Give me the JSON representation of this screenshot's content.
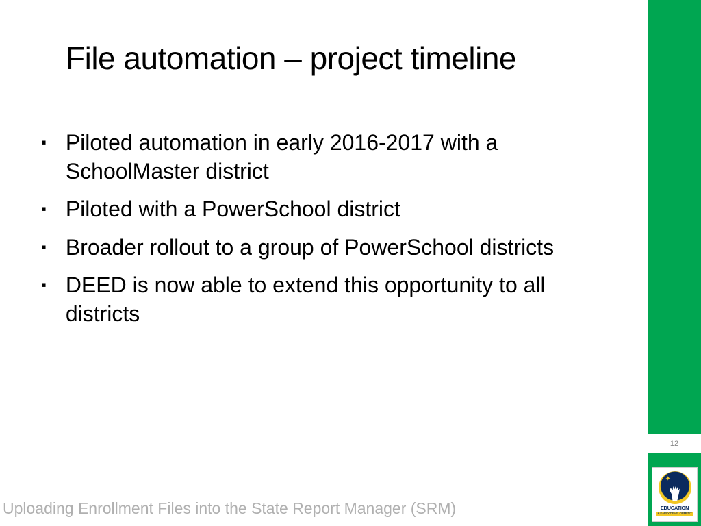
{
  "title": "File automation – project timeline",
  "bullets": [
    "Piloted automation in early 2016-2017 with a SchoolMaster district",
    "Piloted with a PowerSchool district",
    "Broader rollout to a group of PowerSchool districts",
    "DEED is now able to extend this opportunity to all districts"
  ],
  "footer": "Uploading Enrollment Files into the State Report Manager (SRM)",
  "page_number": "12",
  "logo": {
    "main_text": "EDUCATION",
    "sub_text": "& EARLY DEVELOPMENT"
  }
}
